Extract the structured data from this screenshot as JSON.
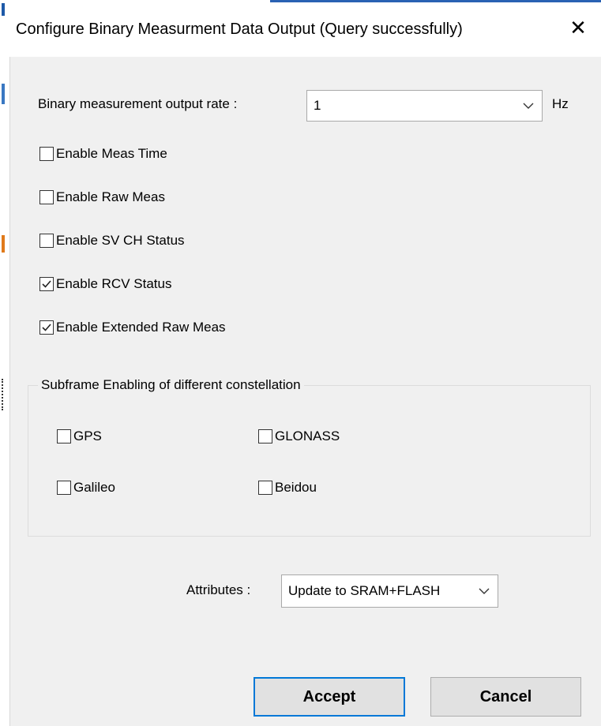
{
  "dialog": {
    "title": "Configure Binary Measurment Data Output (Query successfully)",
    "close_glyph": "✕"
  },
  "rate": {
    "label": "Binary measurement output rate :",
    "value": "1",
    "unit": "Hz"
  },
  "options": [
    {
      "label": "Enable Meas Time",
      "checked": false
    },
    {
      "label": "Enable Raw Meas",
      "checked": false
    },
    {
      "label": "Enable SV CH Status",
      "checked": false
    },
    {
      "label": "Enable RCV Status",
      "checked": true
    },
    {
      "label": "Enable Extended  Raw Meas",
      "checked": true
    }
  ],
  "subframe": {
    "title": "Subframe Enabling of different constellation",
    "items": [
      {
        "label": "GPS",
        "checked": false
      },
      {
        "label": "GLONASS",
        "checked": false
      },
      {
        "label": "Galileo",
        "checked": false
      },
      {
        "label": "Beidou",
        "checked": false
      }
    ]
  },
  "attributes": {
    "label": "Attributes :",
    "value": "Update to SRAM+FLASH"
  },
  "buttons": {
    "accept": "Accept",
    "cancel": "Cancel"
  },
  "colors": {
    "accent": "#0078d7",
    "dialog_bg": "#f0f0f0"
  },
  "icons": {
    "close": "close-icon",
    "dropdown": "chevron-down-icon",
    "check": "checkmark-icon"
  }
}
